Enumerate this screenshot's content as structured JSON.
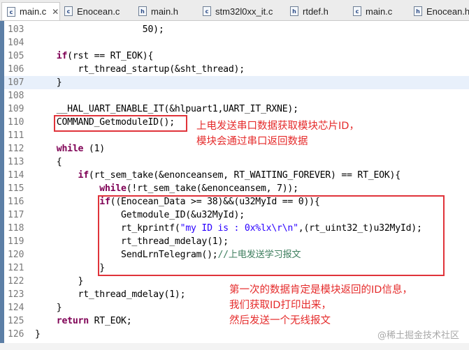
{
  "tabs": [
    {
      "label": "main.c",
      "icon": "c-file-icon",
      "close": "✕"
    },
    {
      "label": "Enocean.c",
      "icon": "c-file-icon"
    },
    {
      "label": "main.h",
      "icon": "h-file-icon"
    },
    {
      "label": "stm32l0xx_it.c",
      "icon": "c-file-icon"
    },
    {
      "label": "rtdef.h",
      "icon": "h-file-icon"
    },
    {
      "label": "main.c",
      "icon": "c-file-icon"
    },
    {
      "label": "Enocean.h",
      "icon": "h-file-icon"
    }
  ],
  "lines": [
    {
      "num": "103",
      "code": "                    50);"
    },
    {
      "num": "104",
      "code": ""
    },
    {
      "num": "105",
      "kw": "if",
      "code": "(rst == RT_EOK){"
    },
    {
      "num": "106",
      "code": "        rt_thread_startup(&sht_thread);"
    },
    {
      "num": "107",
      "code": "    }"
    },
    {
      "num": "108",
      "code": ""
    },
    {
      "num": "109",
      "code": "    __HAL_UART_ENABLE_IT(&hlpuart1,UART_IT_RXNE);"
    },
    {
      "num": "110",
      "code": "    COMMAND_GetmoduleID();"
    },
    {
      "num": "111",
      "code": ""
    },
    {
      "num": "112",
      "kw": "while",
      "code": " (1)"
    },
    {
      "num": "113",
      "code": "    {"
    },
    {
      "num": "114",
      "kw": "if",
      "code": "(rt_sem_take(&enonceansem, RT_WAITING_FOREVER) == RT_EOK){"
    },
    {
      "num": "115",
      "kw": "while",
      "code": "(!rt_sem_take(&enonceansem, 7));"
    },
    {
      "num": "116",
      "kw": "if",
      "code": "((Enocean_Data >= 38)&&(u32MyId == 0)){"
    },
    {
      "num": "117",
      "code": "                Getmodule_ID(&u32MyId);"
    },
    {
      "num": "118",
      "code_pre": "                rt_kprintf(",
      "str": "\"my ID is : 0x%lx\\r\\n\"",
      "code_post": ",(rt_uint32_t)u32MyId);"
    },
    {
      "num": "119",
      "code": "                rt_thread_mdelay(1);"
    },
    {
      "num": "120",
      "code_pre": "                SendLrnTelegram();",
      "comment": "//上电发送学习报文"
    },
    {
      "num": "121",
      "code": "            }"
    },
    {
      "num": "122",
      "code": "        }"
    },
    {
      "num": "123",
      "code": "        rt_thread_mdelay(1);"
    },
    {
      "num": "124",
      "code": "    }"
    },
    {
      "num": "125",
      "kw": "return",
      "code": " RT_EOK;"
    },
    {
      "num": "126",
      "code": "}"
    }
  ],
  "notes": {
    "note1_line1": "上电发送串口数据获取模块芯片ID，",
    "note1_line2": "模块会通过串口返回数据",
    "note2_line1": "第一次的数据肯定是模块返回的ID信息，",
    "note2_line2": "我们获取ID打印出来，",
    "note2_line3": "然后发送一个无线报文"
  },
  "watermark": "@稀土掘金技术社区",
  "colors": {
    "keyword": "#7f0055",
    "string": "#2a00ff",
    "comment": "#3f7f5f",
    "annotation": "#e52b2b",
    "current_line": "#e8f0fb"
  }
}
